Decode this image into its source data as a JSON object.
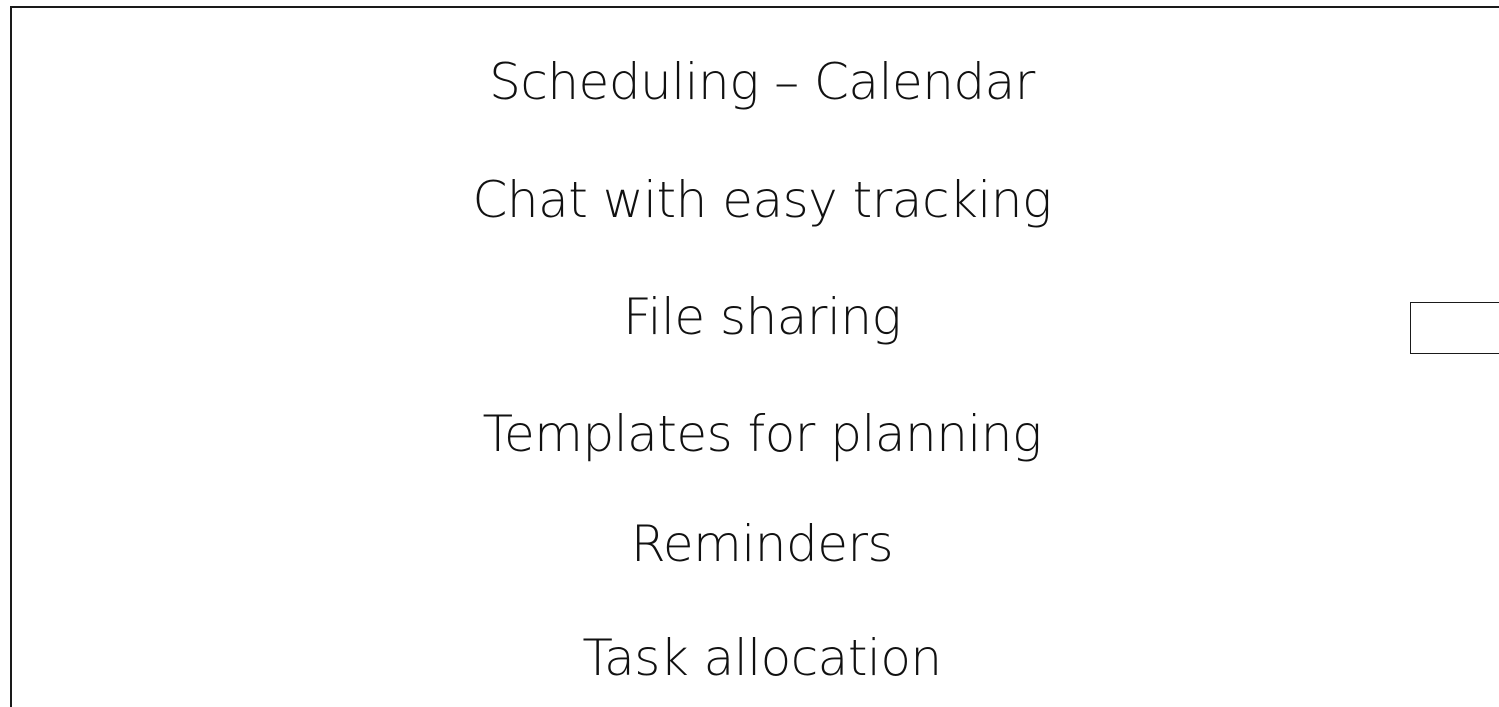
{
  "features": [
    {
      "label": "Scheduling – Calendar"
    },
    {
      "label": "Chat with easy tracking"
    },
    {
      "label": "File sharing"
    },
    {
      "label": "Templates for planning"
    },
    {
      "label": "Reminders"
    },
    {
      "label": "Task allocation"
    }
  ]
}
